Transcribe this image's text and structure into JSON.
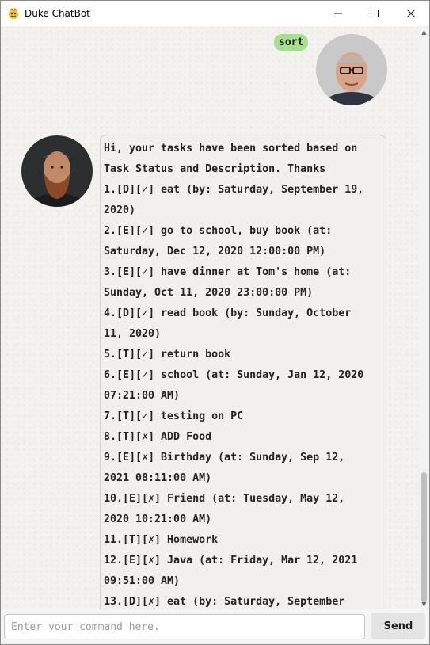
{
  "window": {
    "title": "Duke ChatBot",
    "controls": {
      "minimize": "─",
      "maximize": "☐",
      "close": "✕"
    }
  },
  "chat": {
    "user_message": "sort",
    "bot_lines": [
      "Hi, your tasks have been sorted based on",
      "Task Status and Description. Thanks",
      "1.[D][✓] eat (by: Saturday, September 19,",
      "2020)",
      "2.[E][✓] go to school, buy book (at:",
      "Saturday, Dec 12, 2020 12:00:00 PM)",
      "3.[E][✓] have dinner at Tom's home (at:",
      "Sunday, Oct 11, 2020 23:00:00 PM)",
      "4.[D][✓] read book (by: Sunday, October",
      "11, 2020)",
      "5.[T][✓] return book",
      "6.[E][✓] school (at: Sunday, Jan 12, 2020",
      "07:21:00 AM)",
      "7.[T][✓] testing on PC",
      "8.[T][✗] ADD Food",
      "9.[E][✗] Birthday (at: Sunday, Sep 12,",
      "2021 08:11:00 AM)",
      "10.[E][✗] Friend (at: Tuesday, May 12,",
      "2020 10:21:00 AM)",
      "11.[T][✗] Homework",
      "12.[E][✗] Java (at: Friday, Mar 12, 2021",
      "09:51:00 AM)",
      "13.[D][✗] eat (by: Saturday, September"
    ]
  },
  "input": {
    "placeholder": "Enter your command here.",
    "value": ""
  },
  "send_button": {
    "label": "Send"
  },
  "colors": {
    "user_bubble": "#a5e18a",
    "bot_bubble": "#f1f0ec",
    "background": "#f4f2ee"
  }
}
